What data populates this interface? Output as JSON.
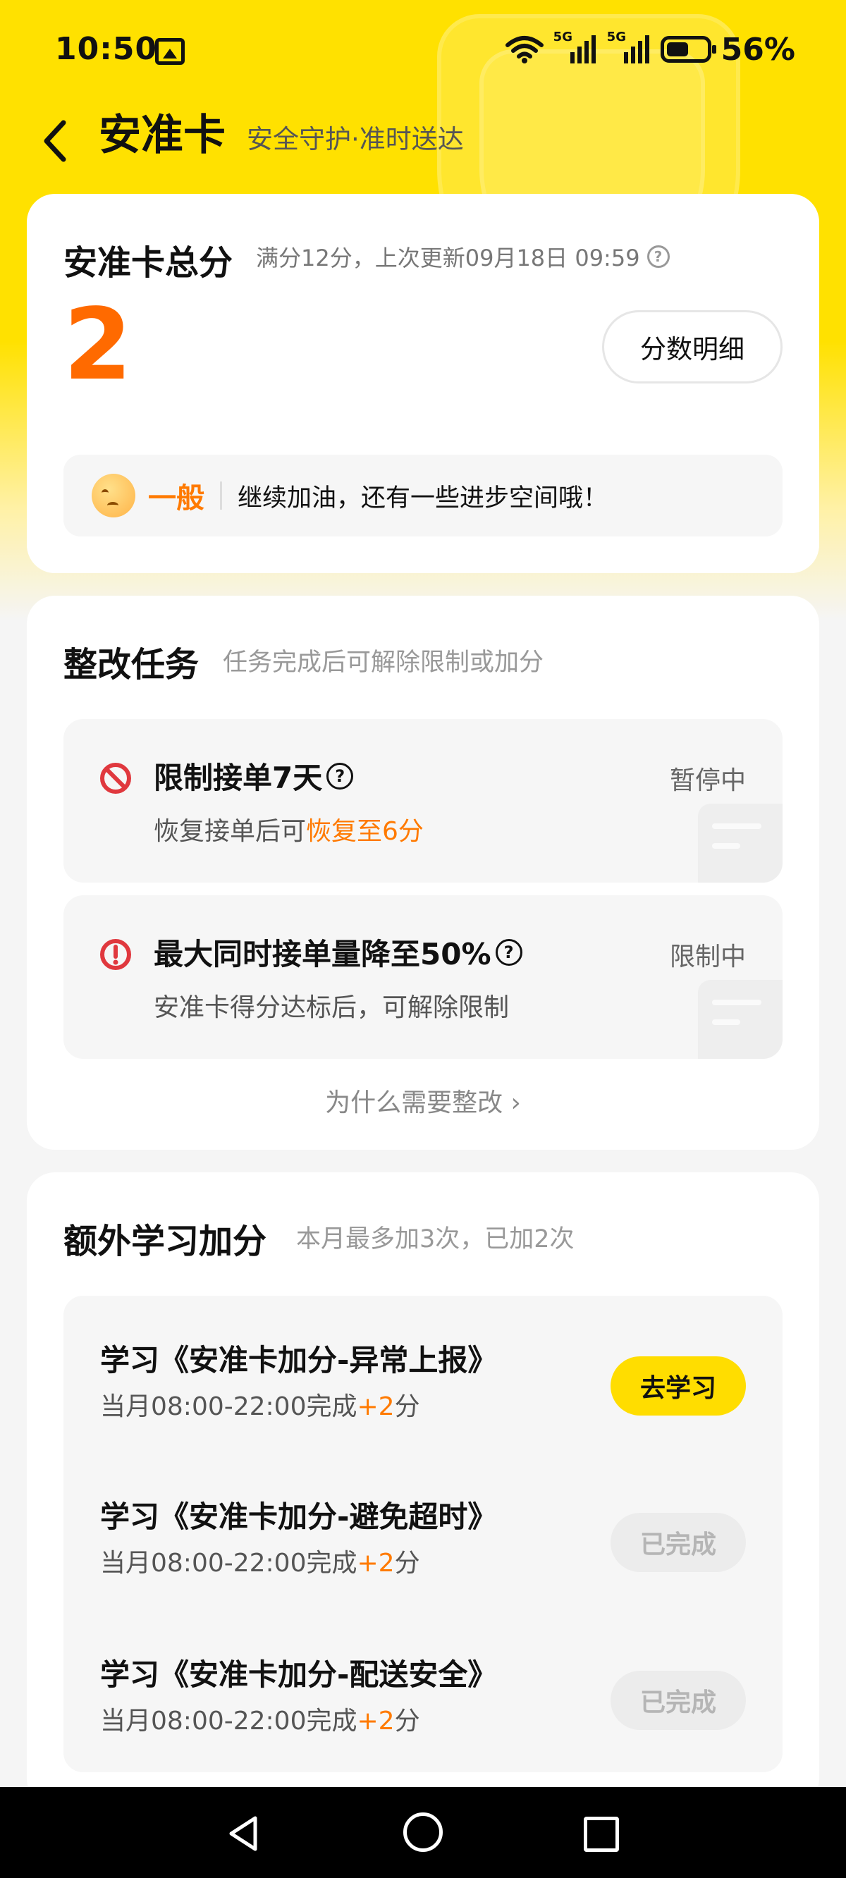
{
  "status_bar": {
    "time": "10:50",
    "network_1": "5G",
    "network_2": "5G",
    "battery": "56%"
  },
  "header": {
    "title": "安准卡",
    "subtitle": "安全守护·准时送达"
  },
  "score_card": {
    "title": "安准卡总分",
    "meta": "满分12分，上次更新09月18日 09:59",
    "score": "2",
    "detail_button": "分数明细",
    "level_label": "一般",
    "level_text": "继续加油，还有一些进步空间哦！"
  },
  "rectify": {
    "title": "整改任务",
    "subtitle": "任务完成后可解除限制或加分",
    "tasks": [
      {
        "title": "限制接单7天",
        "desc_prefix": "恢复接单后可",
        "desc_highlight": "恢复至6分",
        "status": "暂停中",
        "icon": "ban-icon"
      },
      {
        "title": "最大同时接单量降至50%",
        "desc_prefix": "安准卡得分达标后，可解除限制",
        "desc_highlight": "",
        "status": "限制中",
        "icon": "alert-icon"
      }
    ],
    "why_link": "为什么需要整改 ›"
  },
  "study": {
    "title": "额外学习加分",
    "subtitle": "本月最多加3次，已加2次",
    "items": [
      {
        "title": "学习《安准卡加分-异常上报》",
        "desc_prefix": "当月08:00-22:00完成",
        "desc_highlight": "+2",
        "desc_suffix": "分",
        "button": "去学习",
        "state": "go"
      },
      {
        "title": "学习《安准卡加分-避免超时》",
        "desc_prefix": "当月08:00-22:00完成",
        "desc_highlight": "+2",
        "desc_suffix": "分",
        "button": "已完成",
        "state": "done"
      },
      {
        "title": "学习《安准卡加分-配送安全》",
        "desc_prefix": "当月08:00-22:00完成",
        "desc_highlight": "+2",
        "desc_suffix": "分",
        "button": "已完成",
        "state": "done"
      }
    ]
  },
  "colors": {
    "brand_yellow": "#ffe100",
    "score_orange": "#ff6a00",
    "highlight_orange": "#ff7a00",
    "alert_red": "#e0383e"
  }
}
